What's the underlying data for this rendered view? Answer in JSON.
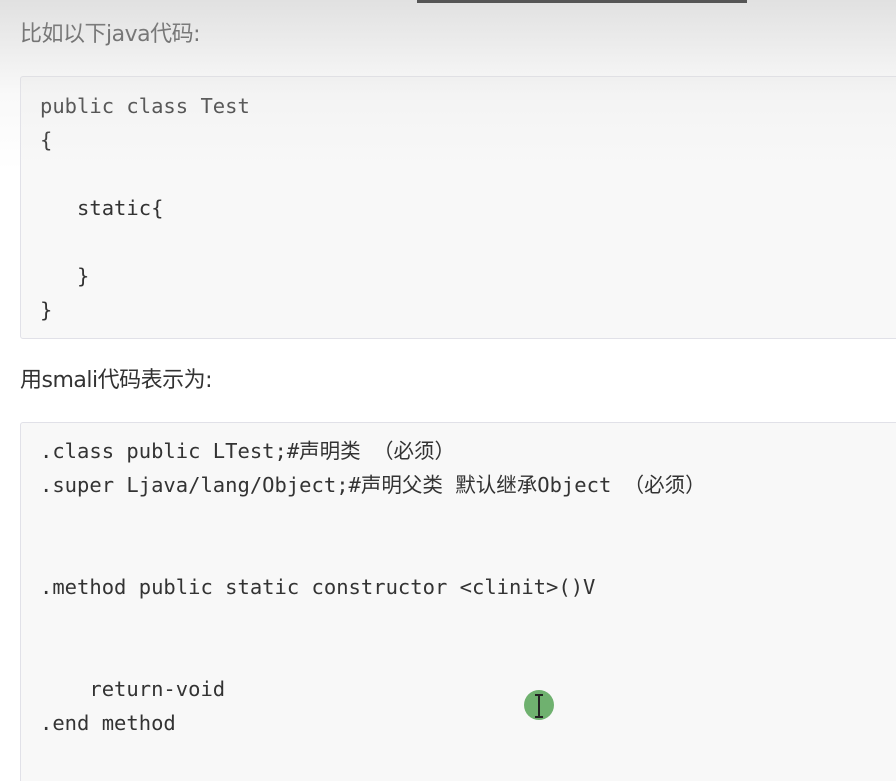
{
  "intro": {
    "java_heading": "比如以下java代码:",
    "smali_heading": "用smali代码表示为:"
  },
  "java_code": {
    "lines": [
      "public class Test",
      "{",
      "",
      "   static{",
      "",
      "   }",
      "}"
    ]
  },
  "smali_code": {
    "lines": [
      ".class public LTest;#声明类 （必须）",
      ".super Ljava/lang/Object;#声明父类 默认继承Object （必须）",
      "",
      "",
      ".method public static constructor <clinit>()V",
      "",
      "",
      "    return-void",
      ".end method"
    ]
  },
  "cursor": {
    "icon": "text-cursor-icon",
    "highlight_color": "#5fa85f"
  }
}
